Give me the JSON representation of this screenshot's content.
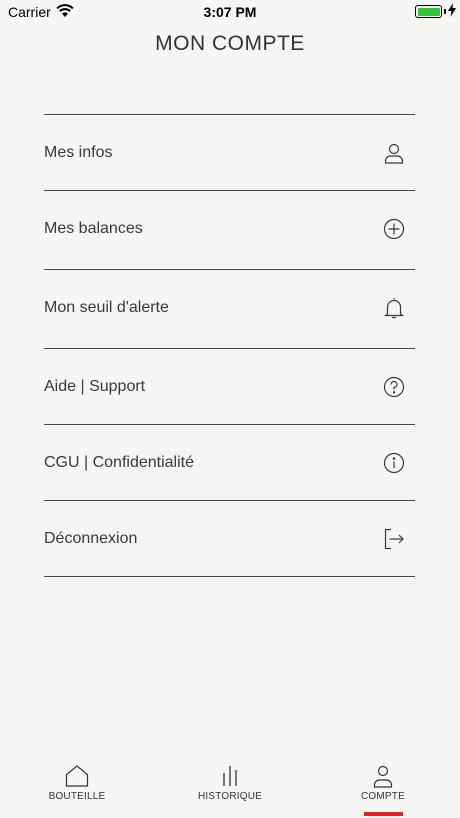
{
  "status_bar": {
    "carrier": "Carrier",
    "time": "3:07 PM",
    "battery_color": "#36c236"
  },
  "header": {
    "title": "MON COMPTE"
  },
  "menu": {
    "items": [
      {
        "label": "Mes infos",
        "icon": "user-icon"
      },
      {
        "label": "Mes balances",
        "icon": "plus-circle-icon"
      },
      {
        "label": "Mon seuil d'alerte",
        "icon": "bell-icon"
      },
      {
        "label": "Aide | Support",
        "icon": "question-circle-icon"
      },
      {
        "label": "CGU | Confidentialité",
        "icon": "info-circle-icon"
      },
      {
        "label": "Déconnexion",
        "icon": "logout-icon"
      }
    ]
  },
  "tabbar": {
    "tabs": [
      {
        "label": "BOUTEILLE",
        "icon": "house-icon"
      },
      {
        "label": "HISTORIQUE",
        "icon": "bars-icon"
      },
      {
        "label": "COMPTE",
        "icon": "user-icon"
      }
    ],
    "active_tab": "COMPTE",
    "accent_color": "#e0242a"
  }
}
